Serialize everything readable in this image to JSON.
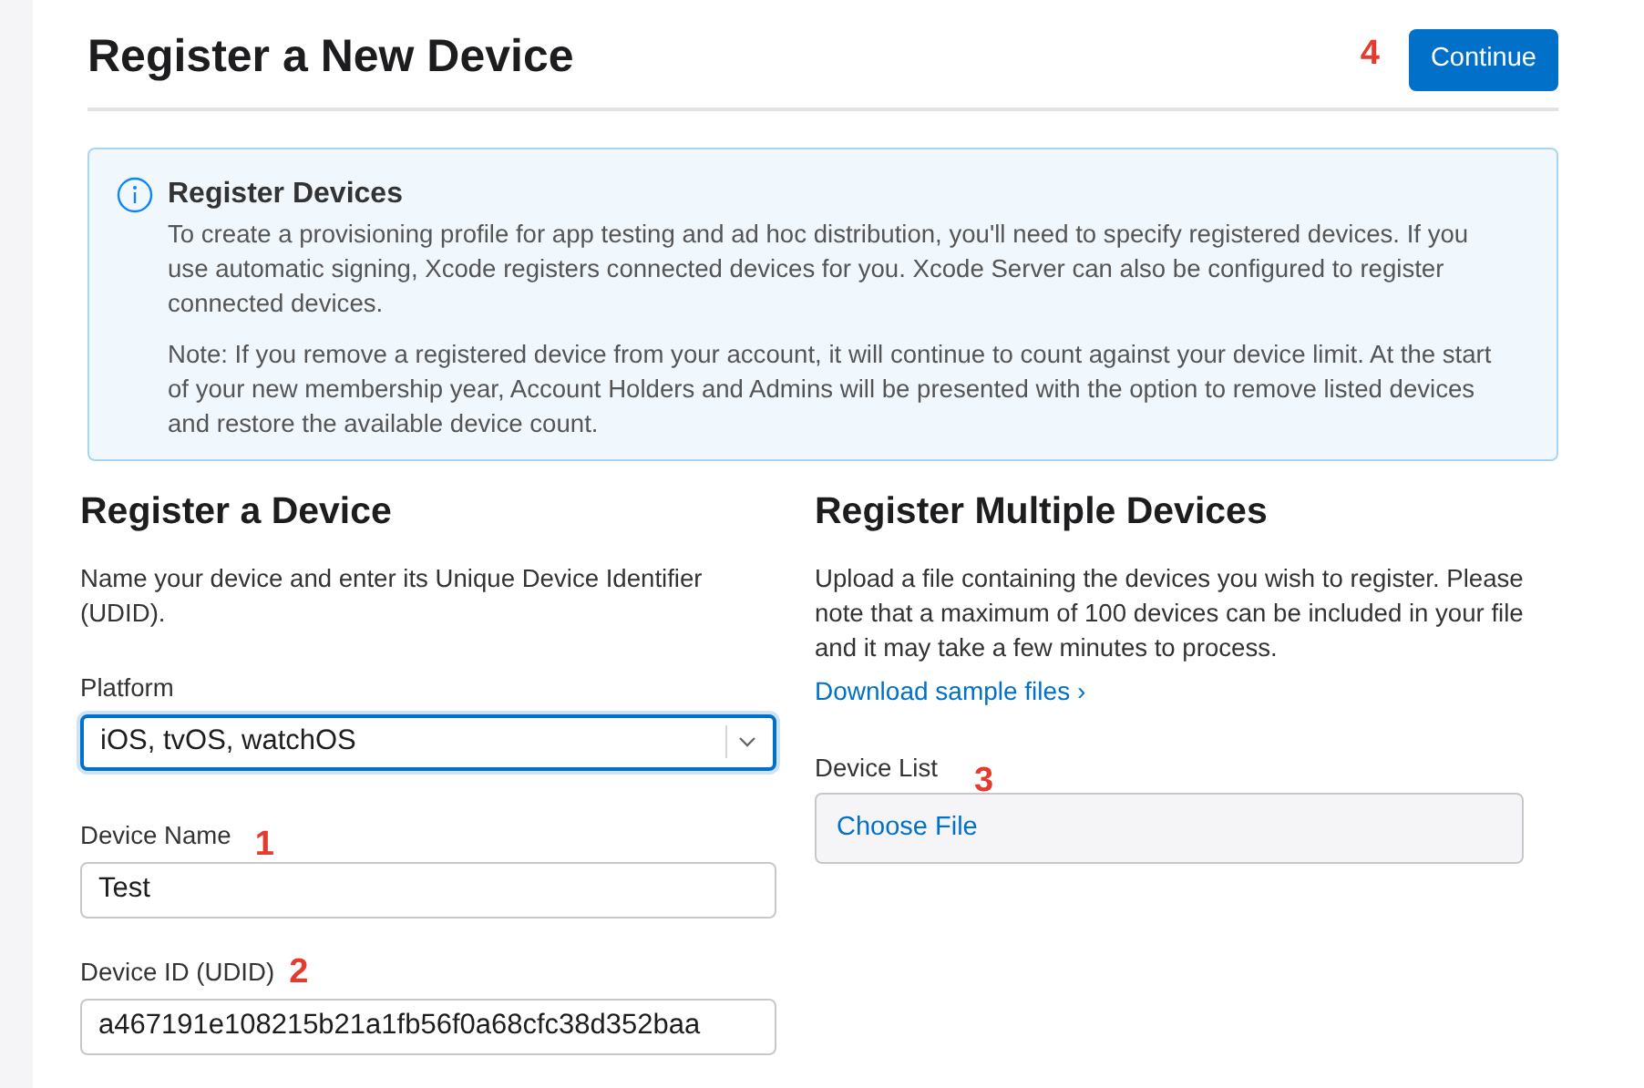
{
  "page_title": "Register a New Device",
  "continue_button": {
    "label": "Continue",
    "annotation": "4"
  },
  "info": {
    "title": "Register Devices",
    "paragraphs": [
      "To create a provisioning profile for app testing and ad hoc distribution, you'll need to specify registered devices. If you use automatic signing, Xcode registers connected devices for you. Xcode Server can also be configured to register connected devices.",
      "Note: If you remove a registered device from your account, it will continue to count against your device limit. At the start of your new membership year, Account Holders and Admins will be presented with the option to remove listed devices and restore the available device count."
    ]
  },
  "register_device": {
    "heading": "Register a Device",
    "description": "Name your device and enter its Unique Device Identifier (UDID).",
    "fields": [
      {
        "kind": "select",
        "label": "Platform",
        "value": "iOS, tvOS, watchOS",
        "focused": true
      },
      {
        "kind": "text",
        "label": "Device Name",
        "value": "Test",
        "focused": false,
        "annotation": "1"
      },
      {
        "kind": "text",
        "label": "Device ID (UDID)",
        "value": "a467191e108215b21a1fb56f0a68cfc38d352baa",
        "focused": false,
        "annotation": "2"
      }
    ]
  },
  "register_multiple": {
    "heading": "Register Multiple Devices",
    "description": "Upload a file containing the devices you wish to register. Please note that a maximum of 100 devices can be included in your file and it may take a few minutes to process.",
    "link": "Download sample files ›",
    "file_field": {
      "label": "Device List",
      "button": "Choose File",
      "annotation": "3"
    }
  }
}
